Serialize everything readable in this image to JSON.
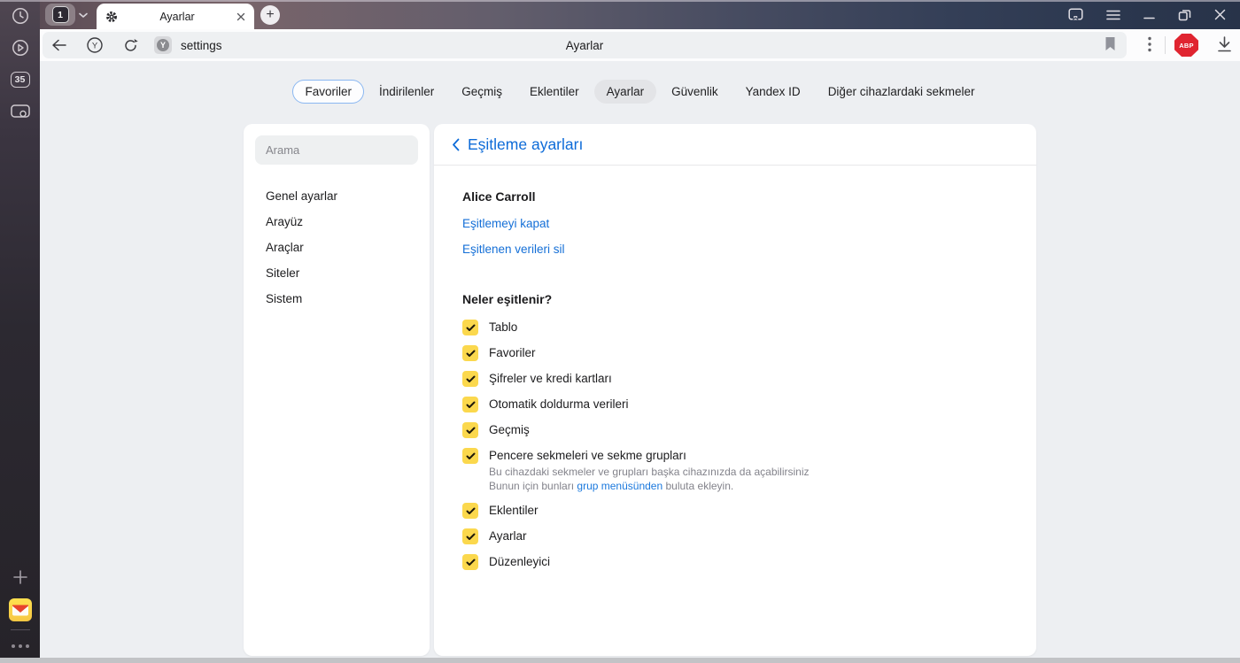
{
  "browser": {
    "tab_count": "1",
    "tabs_badge": "35",
    "tab_title": "Ayarlar",
    "url": "settings",
    "page_title": "Ayarlar",
    "abp": "ABP"
  },
  "nav_tabs": [
    {
      "label": "Favoriler",
      "state": "focused"
    },
    {
      "label": "İndirilenler",
      "state": "normal"
    },
    {
      "label": "Geçmiş",
      "state": "normal"
    },
    {
      "label": "Eklentiler",
      "state": "normal"
    },
    {
      "label": "Ayarlar",
      "state": "active"
    },
    {
      "label": "Güvenlik",
      "state": "normal"
    },
    {
      "label": "Yandex ID",
      "state": "normal"
    },
    {
      "label": "Diğer cihazlardaki sekmeler",
      "state": "normal"
    }
  ],
  "sidebar": {
    "search_placeholder": "Arama",
    "items": [
      {
        "label": "Genel ayarlar"
      },
      {
        "label": "Arayüz"
      },
      {
        "label": "Araçlar"
      },
      {
        "label": "Siteler"
      },
      {
        "label": "Sistem"
      }
    ]
  },
  "main": {
    "header_title": "Eşitleme ayarları",
    "account_name": "Alice Carroll",
    "link_disable": "Eşitlemeyi kapat",
    "link_delete": "Eşitlenen verileri sil",
    "section_title": "Neler eşitlenir?",
    "sync_items": [
      {
        "label": "Tablo",
        "checked": true
      },
      {
        "label": "Favoriler",
        "checked": true
      },
      {
        "label": "Şifreler ve kredi kartları",
        "checked": true
      },
      {
        "label": "Otomatik doldurma verileri",
        "checked": true
      },
      {
        "label": "Geçmiş",
        "checked": true
      },
      {
        "label": "Pencere sekmeleri ve sekme grupları",
        "checked": true,
        "description_line1": "Bu cihazdaki sekmeler ve grupları başka cihazınızda da açabilirsiniz",
        "description_line2_prefix": "Bunun için bunları ",
        "description_link": "grup menüsünden",
        "description_line2_suffix": " buluta ekleyin."
      },
      {
        "label": "Eklentiler",
        "checked": true
      },
      {
        "label": "Ayarlar",
        "checked": true
      },
      {
        "label": "Düzenleyici",
        "checked": true
      }
    ]
  },
  "colors": {
    "accent_blue": "#0d6bd8",
    "link_blue": "#146fd7",
    "checkbox_yellow": "#fbd84d",
    "abp_red": "#e02430",
    "titlebar_left": "#5b4c55",
    "titlebar_right": "#283349",
    "page_background": "#edeff2"
  }
}
